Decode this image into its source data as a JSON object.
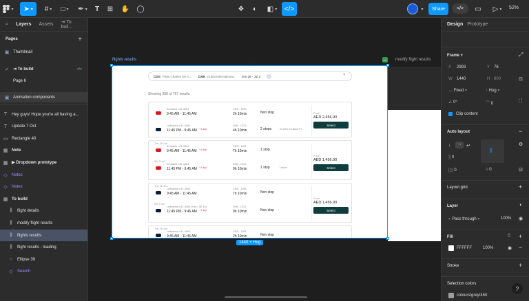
{
  "toolbar": {
    "share_label": "Share",
    "zoom": "52%"
  },
  "left_panel": {
    "tabs": [
      "Layers",
      "Assets",
      "⇥ To buil..."
    ],
    "pages_heading": "Pages",
    "pages": [
      {
        "label": "Thumbnail",
        "icon": "thumbnail-icon"
      },
      {
        "label": "⇥ To build",
        "checked": true
      },
      {
        "label": "Page 6"
      },
      {
        "label": "Animation components"
      }
    ],
    "layers": [
      {
        "label": "Hey guys! Hope you're all having a...",
        "icon": "T",
        "indent": 0
      },
      {
        "label": "Update 7 Oct",
        "icon": "T",
        "indent": 0
      },
      {
        "label": "Rectangle 40",
        "icon": "▭",
        "indent": 0
      },
      {
        "label": "Note",
        "icon": "▦",
        "indent": 0,
        "bold": true
      },
      {
        "label": "▶ Dropdown prototype",
        "icon": "▦",
        "indent": 0,
        "bold": true
      },
      {
        "label": "Notes",
        "icon": "◇",
        "indent": 0,
        "purple": true
      },
      {
        "label": "Notes",
        "icon": "◇",
        "indent": 0,
        "purple": true
      },
      {
        "label": "To build",
        "icon": "▦",
        "indent": 0,
        "bold": true
      },
      {
        "label": "flight details",
        "icon": "⫼",
        "indent": 1
      },
      {
        "label": "modify flight results",
        "icon": "⫼",
        "indent": 1
      },
      {
        "label": "flights results",
        "icon": "⫼",
        "indent": 1,
        "selected": true
      },
      {
        "label": "flight results - loading",
        "icon": "⫼",
        "indent": 1
      },
      {
        "label": "Ellipse 39",
        "icon": "○",
        "indent": 1
      },
      {
        "label": "Search",
        "icon": "◇",
        "indent": 1,
        "purple": true
      }
    ]
  },
  "canvas": {
    "frame_label": "flights results",
    "frame2_label": "modify flight results",
    "size_badge": "1440 × Hug",
    "search": {
      "from_code": "CDG",
      "from_name": "Paris Charles De G...",
      "to_code": "DXB",
      "to_name": "Dubai International...",
      "dates": "Jun 25 - Jul 2"
    },
    "showing": "Showing 358 of 767 results",
    "cards": [
      {
        "rows": [
          {
            "airline": "Emirates • A1 4004",
            "times": "9:45 AM - 11:45 AM",
            "route": "CDG - DXB",
            "dur": "2h 10min",
            "stops": "Non stop"
          },
          {
            "airline": "Lufthansa • A1 4004",
            "times": "11:45 PM - 9:45 AM",
            "plus": "+1 day",
            "route": "DXB - CDG",
            "dur": "4h 10min",
            "stops": "2 stops",
            "stops_detail": "2h 20m in Lisbon Pl..."
          }
        ],
        "from": "From",
        "price": "AED 2,456.90",
        "select": "Select"
      },
      {
        "rows": [
          {
            "tag": "Thu 26 Jun",
            "airline": "Emirates • A1 4004",
            "times": "9:45 AM - 11:45 AM",
            "plus": "+1 day",
            "route": "CDG - DXB",
            "dur": "7h 10min",
            "stops": "1 stop"
          },
          {
            "tag": "Sat 3 Jul",
            "airline": "Emirates • A1 4004",
            "times": "11:45 PM - 9:45 AM",
            "plus": "+1 day",
            "route": "DXB - CDG",
            "dur": "9h 10min",
            "stops": "1 stop",
            "stops_detail": "Lisbon"
          }
        ],
        "from": "From",
        "price": "AED 1,456.90",
        "select": "Select"
      },
      {
        "rows": [
          {
            "tag": "Thu 26 Jun",
            "airline": "Lufthansa • A1 4004",
            "times": "9:45 AM - 11:45 AM",
            "route": "CDG - DXB",
            "dur": "7h 10min",
            "stops": "Non stop"
          },
          {
            "tag": "Sat 3 Jul",
            "airline": "Lufthansa • A1 4004 (+Air • 3E 10)",
            "times": "11:45 PM - 9:45 AM",
            "plus": "+1 day",
            "route": "DXB - CDG",
            "dur": "9h 10min",
            "stops": "Non stop"
          }
        ],
        "from": "From",
        "price": "AED 1,456.90",
        "select": "Select"
      },
      {
        "rows": [
          {
            "tag": "Thu 26 Jun",
            "airline": "Lufthansa • A1 4004",
            "times": "9:45 AM - 11:45 AM",
            "route": "CDG - DXB",
            "dur": "2h 10min",
            "stops": "Non stop"
          }
        ]
      }
    ]
  },
  "right_panel": {
    "tabs": [
      "Design",
      "Prototype"
    ],
    "frame_heading": "Frame",
    "x_label": "X",
    "x": "2993",
    "y_label": "Y",
    "y": "76",
    "w_label": "W",
    "w": "1440",
    "h_label": "H",
    "h": "800",
    "fixed": "Fixed",
    "hug": "Hug",
    "rot": "0°",
    "radius": "0",
    "clip": "Clip content",
    "autolayout": "Auto layout",
    "al_gap": "0",
    "al_pad1": "0",
    "al_pad2": "0",
    "layout_grid": "Layout grid",
    "layer_heading": "Layer",
    "pass": "Pass through",
    "opacity": "100%",
    "fill_heading": "Fill",
    "fill_hex": "FFFFFF",
    "fill_opacity": "100%",
    "stroke": "Stroke",
    "selection_colors": "Selection colors",
    "sel_color": "colours/grey/450",
    "help": "?"
  }
}
